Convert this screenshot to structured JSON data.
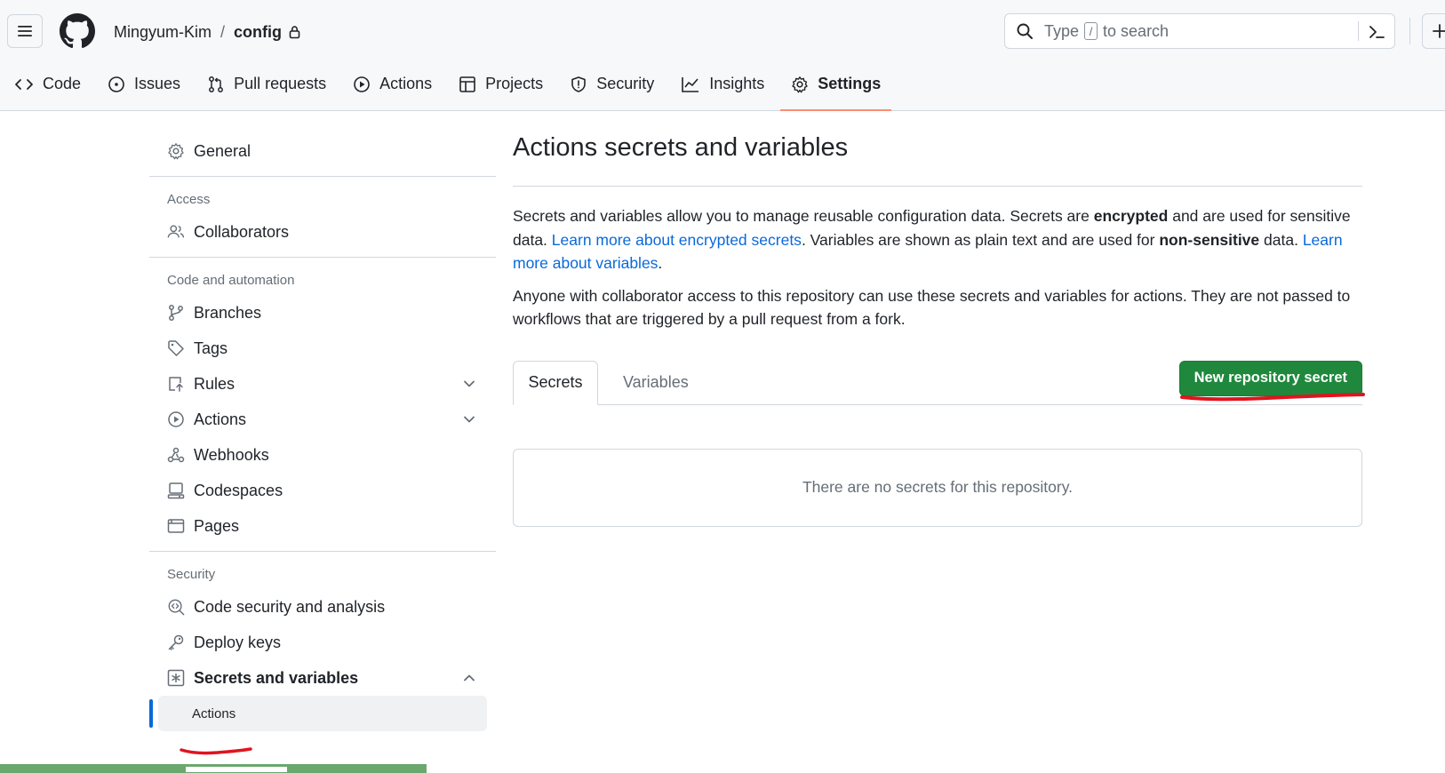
{
  "header": {
    "owner": "Mingyum-Kim",
    "separator": "/",
    "repo": "config",
    "search": {
      "prefix": "Type",
      "key": "/",
      "suffix": "to search"
    }
  },
  "repo_nav": {
    "tabs": [
      {
        "label": "Code",
        "icon": "code-icon"
      },
      {
        "label": "Issues",
        "icon": "issue-icon"
      },
      {
        "label": "Pull requests",
        "icon": "pull-request-icon"
      },
      {
        "label": "Actions",
        "icon": "play-icon"
      },
      {
        "label": "Projects",
        "icon": "table-icon"
      },
      {
        "label": "Security",
        "icon": "shield-icon"
      },
      {
        "label": "Insights",
        "icon": "graph-icon"
      },
      {
        "label": "Settings",
        "icon": "gear-icon",
        "active": true
      }
    ]
  },
  "sidebar": {
    "general": "General",
    "access_heading": "Access",
    "collaborators": "Collaborators",
    "code_automation_heading": "Code and automation",
    "branches": "Branches",
    "tags": "Tags",
    "rules": "Rules",
    "actions": "Actions",
    "webhooks": "Webhooks",
    "codespaces": "Codespaces",
    "pages": "Pages",
    "security_heading": "Security",
    "code_security": "Code security and analysis",
    "deploy_keys": "Deploy keys",
    "secrets_variables": "Secrets and variables",
    "secrets_actions": "Actions"
  },
  "main": {
    "title": "Actions secrets and variables",
    "para1": {
      "t1": "Secrets and variables allow you to manage reusable configuration data. Secrets are ",
      "b1": "encrypted",
      "t2": " and are used for sensitive data. ",
      "link1": "Learn more about encrypted secrets",
      "t3": ". Variables are shown as plain text and are used for ",
      "b2": "non-sensitive",
      "t4": " data. ",
      "link2": "Learn more about variables",
      "t5": "."
    },
    "para2": "Anyone with collaborator access to this repository can use these secrets and variables for actions. They are not passed to workflows that are triggered by a pull request from a fork.",
    "tabs": {
      "secrets": "Secrets",
      "variables": "Variables"
    },
    "new_secret_button": "New repository secret",
    "empty_message": "There are no secrets for this repository."
  },
  "colors": {
    "primary_button": "#1f883d",
    "link": "#0969da",
    "active_tab_underline": "#fd8c73",
    "annotation_red": "#e0141e"
  }
}
